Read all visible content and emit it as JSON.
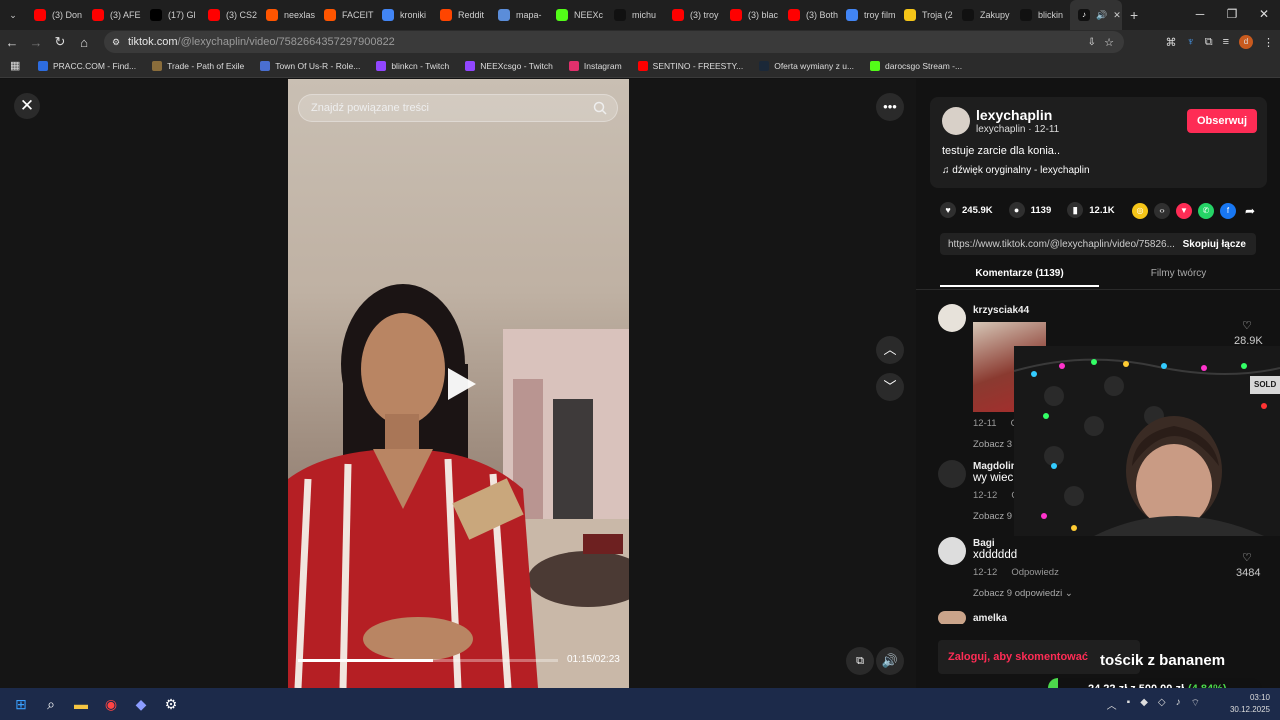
{
  "browser": {
    "tabs": [
      {
        "label": "(3) Don",
        "icon": "youtube-icon",
        "color": "#ff0000"
      },
      {
        "label": "(3) AFE",
        "icon": "youtube-icon",
        "color": "#ff0000"
      },
      {
        "label": "(17) Gl",
        "icon": "x-icon",
        "color": "#000000"
      },
      {
        "label": "(3) CS2",
        "icon": "youtube-icon",
        "color": "#ff0000"
      },
      {
        "label": "neexlas",
        "icon": "faceit-icon",
        "color": "#ff5500"
      },
      {
        "label": "FACEIT",
        "icon": "faceit-icon",
        "color": "#ff5500"
      },
      {
        "label": "kroniki",
        "icon": "google-icon",
        "color": "#4285f4"
      },
      {
        "label": "Reddit",
        "icon": "reddit-icon",
        "color": "#ff4500"
      },
      {
        "label": "mapa-",
        "icon": "map-icon",
        "color": "#5b8dd9"
      },
      {
        "label": "NEEXc",
        "icon": "kick-icon",
        "color": "#53fc18"
      },
      {
        "label": "michu",
        "icon": "tiktok-icon",
        "color": "#111111"
      },
      {
        "label": "(3) troy",
        "icon": "youtube-icon",
        "color": "#ff0000"
      },
      {
        "label": "(3) blac",
        "icon": "youtube-icon",
        "color": "#ff0000"
      },
      {
        "label": "(3) Both",
        "icon": "youtube-icon",
        "color": "#ff0000"
      },
      {
        "label": "troy film",
        "icon": "google-icon",
        "color": "#4285f4"
      },
      {
        "label": "Troja (2",
        "icon": "rating-icon",
        "color": "#f5c518"
      },
      {
        "label": "Zakupy",
        "icon": "tiktok-icon",
        "color": "#111111"
      },
      {
        "label": "blickin",
        "icon": "tiktok-icon",
        "color": "#111111"
      }
    ],
    "active_tab_icon": "tiktok-icon",
    "url_host": "tiktok.com",
    "url_path": "/@lexychaplin/video/7582664357297900822",
    "bookmarks": [
      {
        "label": "PRACC.COM - Find...",
        "color": "#2d6cdf"
      },
      {
        "label": "Trade - Path of Exile",
        "color": "#8a6d3b"
      },
      {
        "label": "Town Of Us-R - Role...",
        "color": "#4a6fd1"
      },
      {
        "label": "blinkcn - Twitch",
        "color": "#9146ff"
      },
      {
        "label": "NEEXcsgo - Twitch",
        "color": "#9146ff"
      },
      {
        "label": "Instagram",
        "color": "#e1306c"
      },
      {
        "label": "SENTINO - FREESTY...",
        "color": "#ff0000"
      },
      {
        "label": "Oferta wymiany z u...",
        "color": "#1b2838"
      },
      {
        "label": "darocsgo Stream -...",
        "color": "#53fc18"
      }
    ]
  },
  "video": {
    "search_placeholder": "Znajdź powiązane treści",
    "time": "01:15/02:23",
    "progress": 0.52
  },
  "side": {
    "username": "lexychaplin",
    "sub": "lexychaplin · 12-11",
    "follow_label": "Obserwuj",
    "description": "testuje zarcie dla konia..",
    "sound": "dźwięk oryginalny - lexychaplin",
    "likes": "245.9K",
    "comments": "1139",
    "saves": "12.1K",
    "link": "https://www.tiktok.com/@lexychaplin/video/75826...",
    "copy_label": "Skopiuj łącze",
    "tab_comments": "Komentarze (1139)",
    "tab_creator": "Filmy twórcy"
  },
  "comments": [
    {
      "name": "krzysciak44",
      "text": "",
      "date": "12-11",
      "reply": "O",
      "more": "Zobacz 3",
      "likes": "28.9K"
    },
    {
      "name": "Magdolin",
      "text": "wy wieci",
      "date": "12-12",
      "reply": "O",
      "more": "Zobacz 9",
      "likes": ""
    },
    {
      "name": "Bagi",
      "text": "xdddddd",
      "date": "12-12",
      "reply": "Odpowiedz",
      "more": "Zobacz 9 odpowiedzi",
      "likes": "3484"
    },
    {
      "name": "amelka",
      "text": "",
      "date": "",
      "reply": "",
      "more": "",
      "likes": ""
    }
  ],
  "stream": {
    "login_prompt": "Zaloguj, aby skomentować",
    "overlay_title": "tościk z bananem",
    "donation_amount": "24,22 zł z 500,00 zł",
    "donation_pct": "(4.84%)",
    "webcam_badge": "SOLD"
  },
  "system": {
    "time": "03:10",
    "date": "30.12.2025"
  }
}
